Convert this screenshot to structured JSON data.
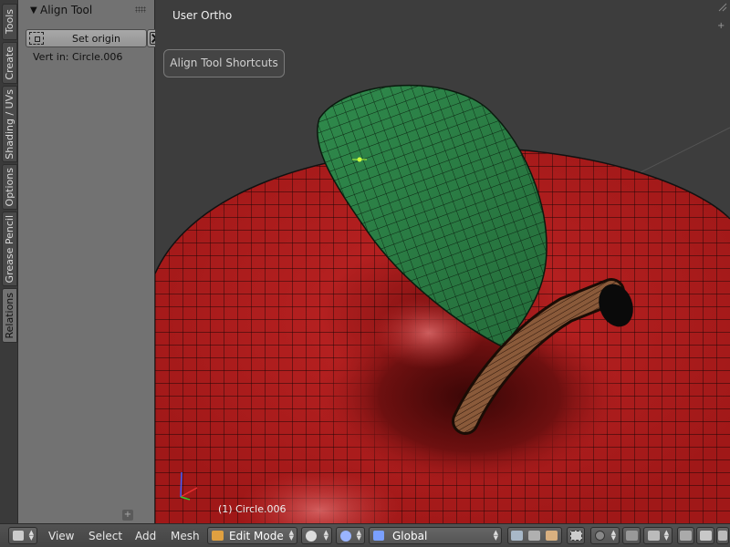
{
  "tool_tabs": [
    "Tools",
    "Create",
    "Shading / UVs",
    "Options",
    "Grease Pencil",
    "Relations"
  ],
  "panel": {
    "title": "Align Tool",
    "set_origin_label": "Set origin",
    "vert_info": "Vert in: Circle.006"
  },
  "viewport": {
    "view_name": "User Ortho",
    "shortcuts_label": "Align Tool Shortcuts",
    "object_info": "(1) Circle.006"
  },
  "header": {
    "menus": [
      "View",
      "Select",
      "Add",
      "Mesh"
    ],
    "mode": "Edit Mode",
    "orientation": "Global"
  },
  "colors": {
    "apple": "#b01c1c",
    "leaf": "#2e7a45",
    "stem": "#8a5a3a",
    "panel_bg": "#727272",
    "viewport_bg": "#3d3d3d"
  }
}
